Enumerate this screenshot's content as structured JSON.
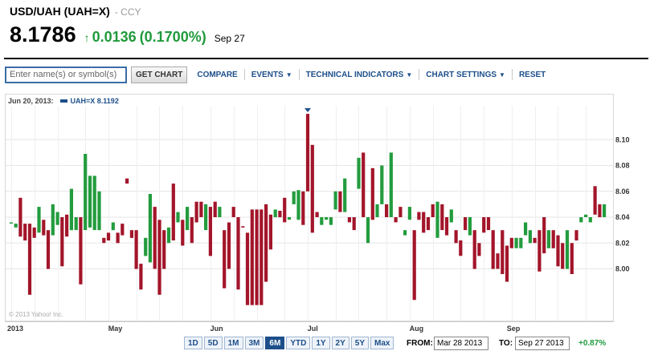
{
  "quote": {
    "title": "USD/UAH (UAH=X)",
    "exchange": "- CCY",
    "price": "8.1786",
    "arrow": "↑",
    "change": "0.0136",
    "change_pct": "(0.1700%)",
    "date": "Sep 27"
  },
  "toolbar": {
    "search_placeholder": "Enter name(s) or symbol(s)",
    "get_chart": "GET CHART",
    "compare": "COMPARE",
    "events": "EVENTS",
    "technical_indicators": "TECHNICAL INDICATORS",
    "chart_settings": "CHART SETTINGS",
    "reset": "RESET"
  },
  "legend": {
    "date": "Jun 20, 2013:",
    "series": "UAH=X 8.1192"
  },
  "copyright": "© 2013 Yahoo! Inc.",
  "range": {
    "buttons": [
      "1D",
      "5D",
      "1M",
      "3M",
      "6M",
      "YTD",
      "1Y",
      "2Y",
      "5Y",
      "Max"
    ],
    "active": "6M"
  },
  "dates": {
    "from_label": "FROM:",
    "from_value": "Mar 28 2013",
    "to_label": "TO:",
    "to_value": "Sep 27 2013",
    "performance": "+0.87%"
  },
  "colors": {
    "up": "#239c3e",
    "down": "#a3152a",
    "accent": "#1d4f8a",
    "grid": "#e6e6e6"
  },
  "chart_data": {
    "type": "candlestick",
    "series_name": "UAH=X",
    "y_ticks": [
      8.0,
      8.02,
      8.04,
      8.06,
      8.08,
      8.1
    ],
    "ylim": [
      7.96,
      8.125
    ],
    "x_labels": [
      "2013",
      "May",
      "Jun",
      "Jul",
      "Aug",
      "Sep"
    ],
    "x_label_index": [
      0,
      22,
      44,
      65,
      87,
      108
    ],
    "grid": true,
    "candles": [
      {
        "o": 8.036,
        "c": 8.036
      },
      {
        "o": 8.032,
        "c": 8.035
      },
      {
        "o": 8.055,
        "c": 8.025
      },
      {
        "o": 8.035,
        "c": 8.022
      },
      {
        "o": 8.035,
        "c": 7.98
      },
      {
        "o": 8.032,
        "c": 8.024
      },
      {
        "o": 8.028,
        "c": 8.048
      },
      {
        "o": 8.038,
        "c": 8.026
      },
      {
        "o": 8.03,
        "c": 8.0
      },
      {
        "o": 8.026,
        "c": 8.05
      },
      {
        "o": 8.034,
        "c": 8.044
      },
      {
        "o": 8.04,
        "c": 8.002
      },
      {
        "o": 8.042,
        "c": 8.025
      },
      {
        "o": 8.03,
        "c": 8.062
      },
      {
        "o": 8.03,
        "c": 8.04
      },
      {
        "o": 8.04,
        "c": 7.988
      },
      {
        "o": 8.03,
        "c": 8.089
      },
      {
        "o": 8.032,
        "c": 8.072
      },
      {
        "o": 8.03,
        "c": 8.072
      },
      {
        "o": 8.03,
        "c": 8.06
      },
      {
        "o": 8.024,
        "c": 8.02
      },
      {
        "o": 8.028,
        "c": 8.022
      },
      {
        "o": 8.03,
        "c": 8.036
      },
      {
        "o": 8.028,
        "c": 8.02
      },
      {
        "o": 8.035,
        "c": 8.026
      },
      {
        "o": 8.07,
        "c": 8.066
      },
      {
        "o": 8.03,
        "c": 8.024
      },
      {
        "o": 8.03,
        "c": 8.0
      },
      {
        "o": 8.004,
        "c": 7.984
      },
      {
        "o": 8.01,
        "c": 8.024
      },
      {
        "o": 8.005,
        "c": 8.058
      },
      {
        "o": 8.048,
        "c": 8.0
      },
      {
        "o": 8.038,
        "c": 7.98
      },
      {
        "o": 8.03,
        "c": 8.0
      },
      {
        "o": 8.02,
        "c": 8.032
      },
      {
        "o": 8.066,
        "c": 8.022
      },
      {
        "o": 8.036,
        "c": 8.044
      },
      {
        "o": 8.038,
        "c": 8.018
      },
      {
        "o": 8.03,
        "c": 8.048
      },
      {
        "o": 8.04,
        "c": 8.02
      },
      {
        "o": 8.052,
        "c": 8.036
      },
      {
        "o": 8.052,
        "c": 8.04
      },
      {
        "o": 8.03,
        "c": 8.05
      },
      {
        "o": 8.048,
        "c": 8.01
      },
      {
        "o": 8.052,
        "c": 8.04
      },
      {
        "o": 8.04,
        "c": 8.048
      },
      {
        "o": 8.03,
        "c": 7.985
      },
      {
        "o": 8.036,
        "c": 8.0
      },
      {
        "o": 8.048,
        "c": 8.04
      },
      {
        "o": 8.04,
        "c": 7.984
      },
      {
        "o": 8.033,
        "c": 8.032
      },
      {
        "o": 8.028,
        "c": 7.972
      },
      {
        "o": 8.046,
        "c": 7.972
      },
      {
        "o": 8.046,
        "c": 7.972
      },
      {
        "o": 8.046,
        "c": 7.972
      },
      {
        "o": 8.05,
        "c": 7.99
      },
      {
        "o": 8.042,
        "c": 8.015
      },
      {
        "o": 8.04,
        "c": 8.046
      },
      {
        "o": 8.045,
        "c": 8.04
      },
      {
        "o": 8.055,
        "c": 8.036
      },
      {
        "o": 8.038,
        "c": 8.04
      },
      {
        "o": 8.05,
        "c": 8.06
      },
      {
        "o": 8.038,
        "c": 8.061
      },
      {
        "o": 8.06,
        "c": 8.034
      },
      {
        "o": 8.12,
        "c": 8.06
      },
      {
        "o": 8.096,
        "c": 8.028
      },
      {
        "o": 8.044,
        "c": 8.04
      },
      {
        "o": 8.034,
        "c": 8.04
      },
      {
        "o": 8.038,
        "c": 8.04
      },
      {
        "o": 8.034,
        "c": 8.04
      },
      {
        "o": 8.046,
        "c": 8.06
      },
      {
        "o": 8.06,
        "c": 8.044
      },
      {
        "o": 8.044,
        "c": 8.07
      },
      {
        "o": 8.04,
        "c": 8.036
      },
      {
        "o": 8.04,
        "c": 8.03
      },
      {
        "o": 8.062,
        "c": 8.086
      },
      {
        "o": 8.09,
        "c": 8.04
      },
      {
        "o": 8.02,
        "c": 8.04
      },
      {
        "o": 8.078,
        "c": 8.038
      },
      {
        "o": 8.04,
        "c": 8.05
      },
      {
        "o": 8.05,
        "c": 8.08
      },
      {
        "o": 8.05,
        "c": 8.04
      },
      {
        "o": 8.04,
        "c": 8.09
      },
      {
        "o": 8.04,
        "c": 8.036
      },
      {
        "o": 8.048,
        "c": 8.04
      },
      {
        "o": 8.026,
        "c": 8.03
      },
      {
        "o": 8.038,
        "c": 8.048
      },
      {
        "o": 8.03,
        "c": 7.976
      },
      {
        "o": 8.044,
        "c": 8.038
      },
      {
        "o": 8.044,
        "c": 8.028
      },
      {
        "o": 8.04,
        "c": 8.03
      },
      {
        "o": 8.05,
        "c": 8.04
      },
      {
        "o": 8.024,
        "c": 8.052
      },
      {
        "o": 8.05,
        "c": 8.03
      },
      {
        "o": 8.04,
        "c": 8.026
      },
      {
        "o": 8.036,
        "c": 8.046
      },
      {
        "o": 8.03,
        "c": 8.02
      },
      {
        "o": 8.022,
        "c": 8.01
      },
      {
        "o": 8.04,
        "c": 8.03
      },
      {
        "o": 8.026,
        "c": 8.04
      },
      {
        "o": 8.03,
        "c": 8.0
      },
      {
        "o": 8.02,
        "c": 8.01
      },
      {
        "o": 8.04,
        "c": 8.028
      },
      {
        "o": 8.04,
        "c": 8.03
      },
      {
        "o": 8.03,
        "c": 8.0
      },
      {
        "o": 8.012,
        "c": 8.0
      },
      {
        "o": 8.03,
        "c": 7.996
      },
      {
        "o": 8.018,
        "c": 7.99
      },
      {
        "o": 8.024,
        "c": 8.016
      },
      {
        "o": 8.016,
        "c": 8.024
      },
      {
        "o": 8.016,
        "c": 8.024
      },
      {
        "o": 8.026,
        "c": 8.036
      },
      {
        "o": 8.02,
        "c": 8.03
      },
      {
        "o": 8.024,
        "c": 8.02
      },
      {
        "o": 8.03,
        "c": 7.998
      },
      {
        "o": 8.04,
        "c": 8.012
      },
      {
        "o": 8.016,
        "c": 8.03
      },
      {
        "o": 8.03,
        "c": 8.016
      },
      {
        "o": 8.026,
        "c": 8.002
      },
      {
        "o": 8.02,
        "c": 8.0
      },
      {
        "o": 8.0,
        "c": 8.03
      },
      {
        "o": 8.02,
        "c": 7.996
      },
      {
        "o": 8.03,
        "c": 8.022
      },
      {
        "o": 8.036,
        "c": 8.04
      },
      {
        "o": 8.04,
        "c": 8.042
      },
      {
        "o": 8.036,
        "c": 8.04
      },
      {
        "o": 8.064,
        "c": 8.042
      },
      {
        "o": 8.05,
        "c": 8.04
      },
      {
        "o": 8.04,
        "c": 8.05
      }
    ]
  }
}
